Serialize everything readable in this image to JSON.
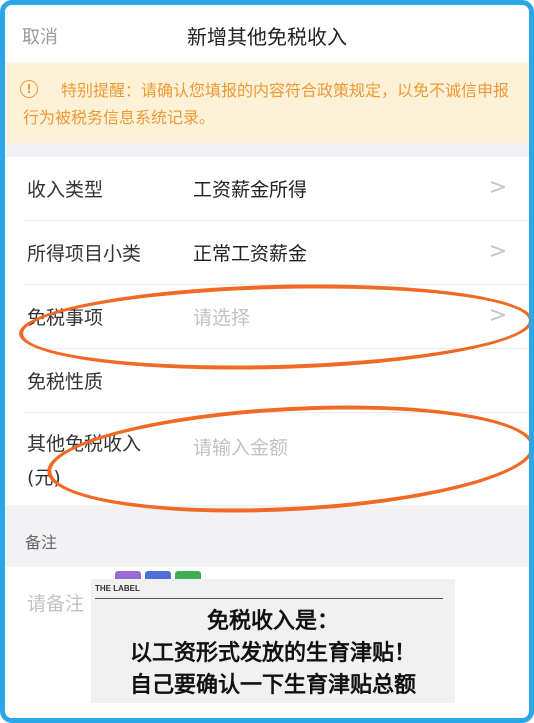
{
  "nav": {
    "cancel_label": "取消",
    "title": "新增其他免税收入"
  },
  "notice": {
    "icon": "warning-circle-icon",
    "text": "特别提醒：请确认您填报的内容符合政策规定，以免不诚信申报行为被税务信息系统记录。"
  },
  "form": {
    "rows": [
      {
        "label": "收入类型",
        "value": "工资薪金所得",
        "placeholder": "",
        "has_chevron": true
      },
      {
        "label": "所得项目小类",
        "value": "正常工资薪金",
        "placeholder": "",
        "has_chevron": true
      },
      {
        "label": "免税事项",
        "value": "",
        "placeholder": "请选择",
        "has_chevron": true
      },
      {
        "label": "免税性质",
        "value": "",
        "placeholder": "",
        "has_chevron": false
      },
      {
        "label_line1": "其他免税收入",
        "label_line2": "(元)",
        "value": "",
        "placeholder": "请输入金额",
        "has_chevron": false
      }
    ]
  },
  "remarks": {
    "section_label": "备注",
    "placeholder": "请备注"
  },
  "overlay": {
    "small_label": "THE LABEL",
    "lines": [
      "免税收入是：",
      "以工资形式发放的生育津贴！",
      "自己要确认一下生育津贴总额"
    ]
  },
  "colors": {
    "frame_border": "#2aa7e8",
    "annotation": "#f06a24",
    "notice_text": "#ef9a35",
    "notice_bg": "#fdf2d8"
  }
}
